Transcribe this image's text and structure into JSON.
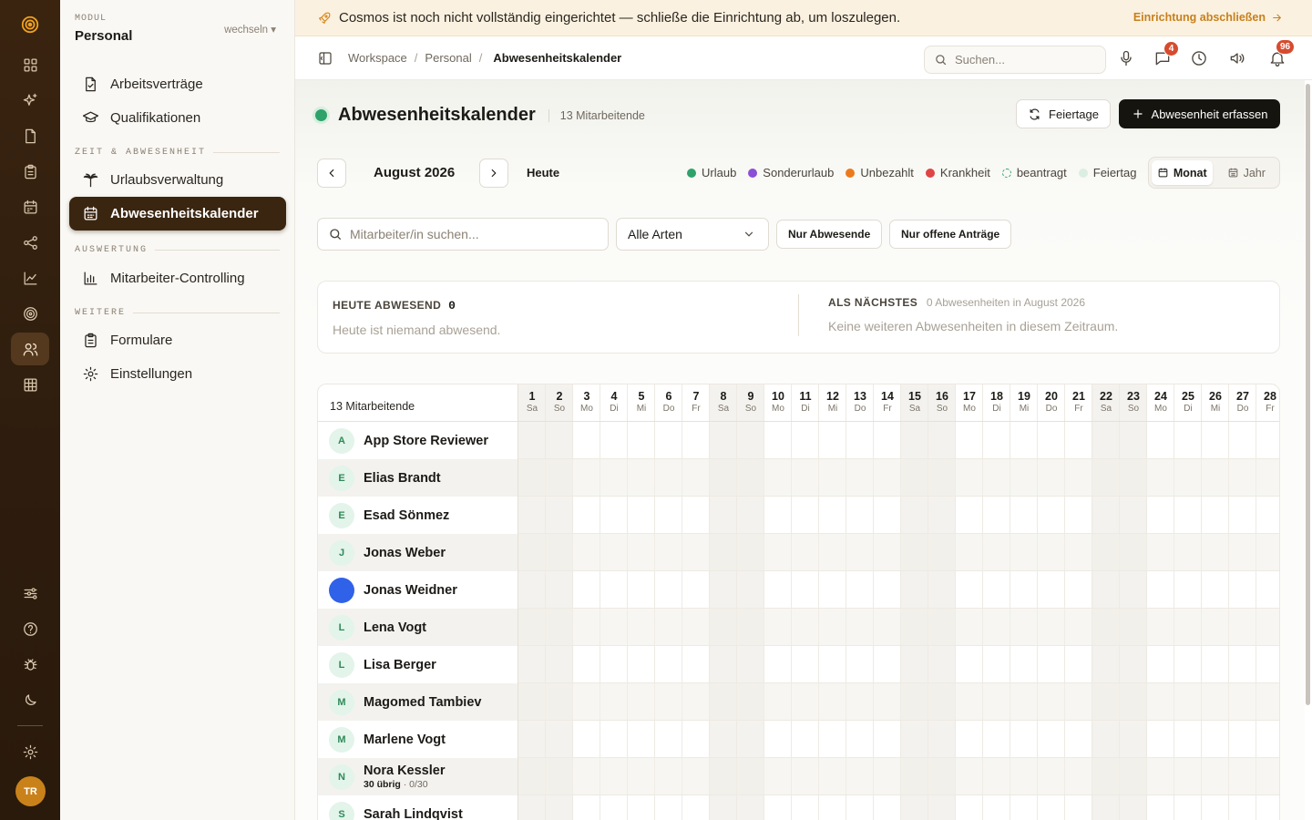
{
  "rail": {
    "icons": [
      "target-icon",
      "grid-icon",
      "sparkle-icon",
      "document-icon",
      "clipboard-icon",
      "calendar-icon",
      "share-icon",
      "chart-icon",
      "radar-icon",
      "users-icon",
      "table-icon"
    ],
    "bottom_icons": [
      "sliders-icon",
      "help-icon",
      "bug-icon",
      "moon-icon",
      "gear-icon"
    ],
    "user_initials": "TR"
  },
  "sidebar": {
    "module_label": "MODUL",
    "module_name": "Personal",
    "switch_label": "wechseln ▾",
    "items_top": [
      {
        "label": "Arbeitsverträge"
      },
      {
        "label": "Qualifikationen"
      }
    ],
    "section_time": "ZEIT & ABWESENHEIT",
    "items_time": [
      {
        "label": "Urlaubsverwaltung"
      },
      {
        "label": "Abwesenheitskalender",
        "active": true
      }
    ],
    "section_eval": "AUSWERTUNG",
    "items_eval": [
      {
        "label": "Mitarbeiter-Controlling"
      }
    ],
    "section_more": "WEITERE",
    "items_more": [
      {
        "label": "Formulare"
      },
      {
        "label": "Einstellungen"
      }
    ]
  },
  "banner": {
    "message": "Cosmos ist noch nicht vollständig eingerichtet — schließe die Einrichtung ab, um loszulegen.",
    "cta": "Einrichtung abschließen"
  },
  "topbar": {
    "breadcrumb": [
      "Workspace",
      "Personal",
      "Abwesenheitskalender"
    ],
    "search_placeholder": "Suchen...",
    "messages_badge": "4",
    "notifications_badge": "96"
  },
  "page": {
    "title": "Abwesenheitskalender",
    "count": "13 Mitarbeitende",
    "holidays_button": "Feiertage",
    "add_button": "Abwesenheit erfassen",
    "month": "August 2026",
    "today": "Heute",
    "legend": [
      {
        "label": "Urlaub",
        "color": "#2ea26a",
        "dashed": false
      },
      {
        "label": "Sonderurlaub",
        "color": "#8c4fd6",
        "dashed": false
      },
      {
        "label": "Unbezahlt",
        "color": "#ec7a1c",
        "dashed": false
      },
      {
        "label": "Krankheit",
        "color": "#df4545",
        "dashed": false
      },
      {
        "label": "beantragt",
        "color": "#2ea26a",
        "dashed": true
      },
      {
        "label": "Feiertag",
        "color": "#dbeee2",
        "dashed": false
      }
    ],
    "view_month": "Monat",
    "view_year": "Jahr",
    "filter_placeholder": "Mitarbeiter/in suchen...",
    "type_select": "Alle Arten",
    "chip_absent": "Nur Abwesende",
    "chip_open": "Nur offene Anträge"
  },
  "summary": {
    "today_label": "HEUTE ABWESEND",
    "today_count": "0",
    "today_text": "Heute ist niemand abwesend.",
    "next_label": "ALS NÄCHSTES",
    "next_sub": "0 Abwesenheiten in August 2026",
    "next_text": "Keine weiteren Abwesenheiten in diesem Zeitraum."
  },
  "calendar": {
    "header_label": "13 Mitarbeitende",
    "days": [
      {
        "d": "1",
        "w": "Sa",
        "we": true
      },
      {
        "d": "2",
        "w": "So",
        "we": true
      },
      {
        "d": "3",
        "w": "Mo",
        "we": false
      },
      {
        "d": "4",
        "w": "Di",
        "we": false
      },
      {
        "d": "5",
        "w": "Mi",
        "we": false
      },
      {
        "d": "6",
        "w": "Do",
        "we": false
      },
      {
        "d": "7",
        "w": "Fr",
        "we": false
      },
      {
        "d": "8",
        "w": "Sa",
        "we": true
      },
      {
        "d": "9",
        "w": "So",
        "we": true
      },
      {
        "d": "10",
        "w": "Mo",
        "we": false
      },
      {
        "d": "11",
        "w": "Di",
        "we": false
      },
      {
        "d": "12",
        "w": "Mi",
        "we": false
      },
      {
        "d": "13",
        "w": "Do",
        "we": false
      },
      {
        "d": "14",
        "w": "Fr",
        "we": false
      },
      {
        "d": "15",
        "w": "Sa",
        "we": true
      },
      {
        "d": "16",
        "w": "So",
        "we": true
      },
      {
        "d": "17",
        "w": "Mo",
        "we": false
      },
      {
        "d": "18",
        "w": "Di",
        "we": false
      },
      {
        "d": "19",
        "w": "Mi",
        "we": false
      },
      {
        "d": "20",
        "w": "Do",
        "we": false
      },
      {
        "d": "21",
        "w": "Fr",
        "we": false
      },
      {
        "d": "22",
        "w": "Sa",
        "we": true
      },
      {
        "d": "23",
        "w": "So",
        "we": true
      },
      {
        "d": "24",
        "w": "Mo",
        "we": false
      },
      {
        "d": "25",
        "w": "Di",
        "we": false
      },
      {
        "d": "26",
        "w": "Mi",
        "we": false
      },
      {
        "d": "27",
        "w": "Do",
        "we": false
      },
      {
        "d": "28",
        "w": "Fr",
        "we": false
      }
    ],
    "people": [
      {
        "initial": "A",
        "name": "App Store Reviewer"
      },
      {
        "initial": "E",
        "name": "Elias Brandt"
      },
      {
        "initial": "E",
        "name": "Esad Sönmez"
      },
      {
        "initial": "J",
        "name": "Jonas Weber"
      },
      {
        "initial": "",
        "name": "Jonas Weidner",
        "photo": true
      },
      {
        "initial": "L",
        "name": "Lena Vogt"
      },
      {
        "initial": "L",
        "name": "Lisa Berger"
      },
      {
        "initial": "M",
        "name": "Magomed Tambiev"
      },
      {
        "initial": "M",
        "name": "Marlene Vogt"
      },
      {
        "initial": "N",
        "name": "Nora Kessler",
        "remaining": "30 übrig",
        "used": "0/30"
      },
      {
        "initial": "S",
        "name": "Sarah Lindqvist"
      }
    ]
  }
}
